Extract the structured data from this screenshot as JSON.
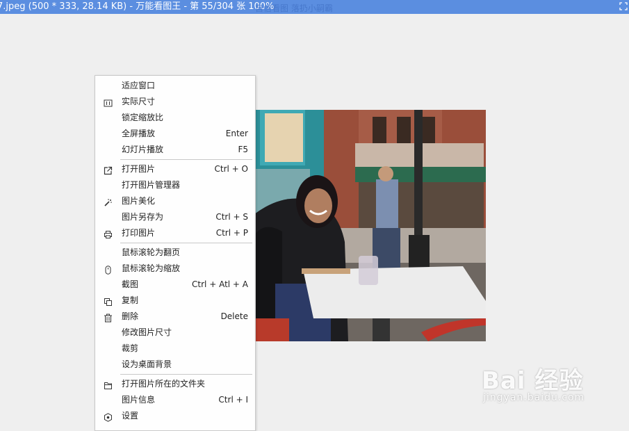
{
  "window": {
    "title": "7.jpeg (500 * 333, 28.14 KB) - 万能看图王 - 第 55/304 张 100%",
    "ghost_title": "自信看图 落扔小嗣霸"
  },
  "menu": {
    "items": [
      {
        "label": "适应窗口",
        "shortcut": "",
        "icon": ""
      },
      {
        "label": "实际尺寸",
        "shortcut": "",
        "icon": "actual-size-icon"
      },
      {
        "label": "锁定缩放比",
        "shortcut": "",
        "icon": ""
      },
      {
        "label": "全屏播放",
        "shortcut": "Enter",
        "icon": ""
      },
      {
        "label": "幻灯片播放",
        "shortcut": "F5",
        "icon": ""
      },
      {
        "label": "打开图片",
        "shortcut": "Ctrl + O",
        "icon": "open-external-icon"
      },
      {
        "label": "打开图片管理器",
        "shortcut": "",
        "icon": ""
      },
      {
        "label": "图片美化",
        "shortcut": "",
        "icon": "magic-wand-icon"
      },
      {
        "label": "图片另存为",
        "shortcut": "Ctrl + S",
        "icon": ""
      },
      {
        "label": "打印图片",
        "shortcut": "Ctrl + P",
        "icon": "printer-icon"
      },
      {
        "label": "鼠标滚轮为翻页",
        "shortcut": "",
        "icon": ""
      },
      {
        "label": "鼠标滚轮为缩放",
        "shortcut": "",
        "icon": "mouse-icon"
      },
      {
        "label": "截图",
        "shortcut": "Ctrl + Atl + A",
        "icon": ""
      },
      {
        "label": "复制",
        "shortcut": "",
        "icon": "copy-icon"
      },
      {
        "label": "删除",
        "shortcut": "Delete",
        "icon": "trash-icon"
      },
      {
        "label": "修改图片尺寸",
        "shortcut": "",
        "icon": ""
      },
      {
        "label": "裁剪",
        "shortcut": "",
        "icon": ""
      },
      {
        "label": "设为桌面背景",
        "shortcut": "",
        "icon": ""
      },
      {
        "label": "打开图片所在的文件夹",
        "shortcut": "",
        "icon": "folder-icon"
      },
      {
        "label": "图片信息",
        "shortcut": "Ctrl + I",
        "icon": ""
      },
      {
        "label": "设置",
        "shortcut": "",
        "icon": "settings-icon"
      }
    ]
  },
  "watermark": {
    "logo": "Bai 经验",
    "url": "jingyan.baidu.com"
  }
}
